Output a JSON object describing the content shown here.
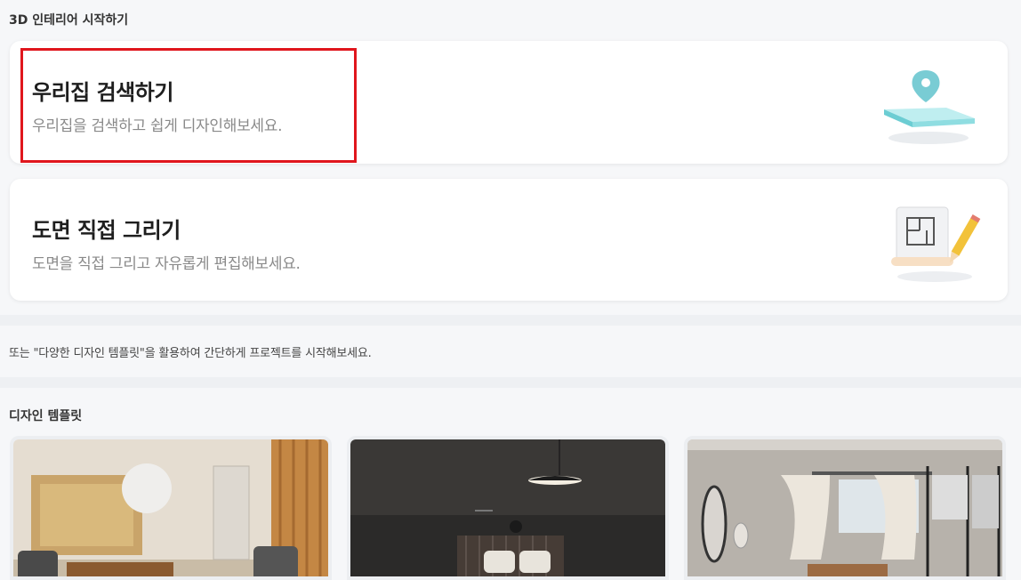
{
  "header": {
    "title": "3D 인테리어 시작하기"
  },
  "cards": [
    {
      "title": "우리집 검색하기",
      "subtitle": "우리집을 검색하고 쉽게 디자인해보세요."
    },
    {
      "title": "도면 직접 그리기",
      "subtitle": "도면을 직접 그리고 자유롭게 편집해보세요."
    }
  ],
  "note": "또는 \"다양한 디자인 템플릿\"을 활용하여 간단하게 프로젝트를 시작해보세요.",
  "templates": {
    "title": "디자인 템플릿",
    "items": [
      {
        "icon": "living-room-template-image"
      },
      {
        "icon": "bedroom-template-image"
      },
      {
        "icon": "dressing-room-template-image"
      }
    ]
  },
  "colors": {
    "highlight": "#e0161d",
    "teal": "#6ccdd3"
  }
}
